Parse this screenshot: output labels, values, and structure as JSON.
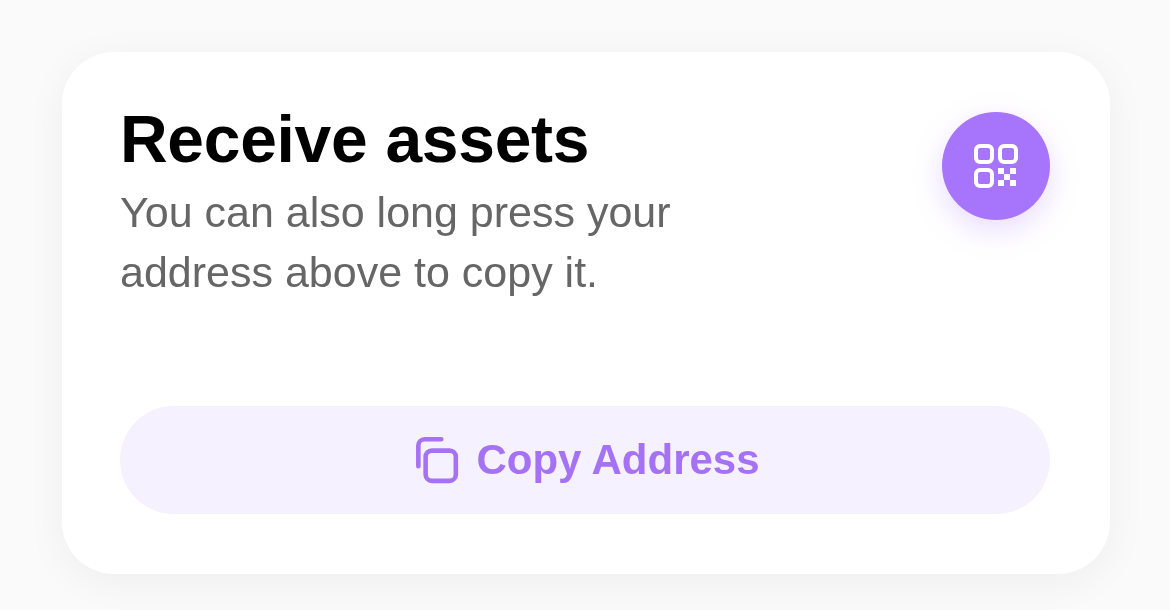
{
  "card": {
    "title": "Receive assets",
    "description": "You can also long press your address above to copy it.",
    "copy_button": {
      "label": "Copy Address"
    }
  }
}
